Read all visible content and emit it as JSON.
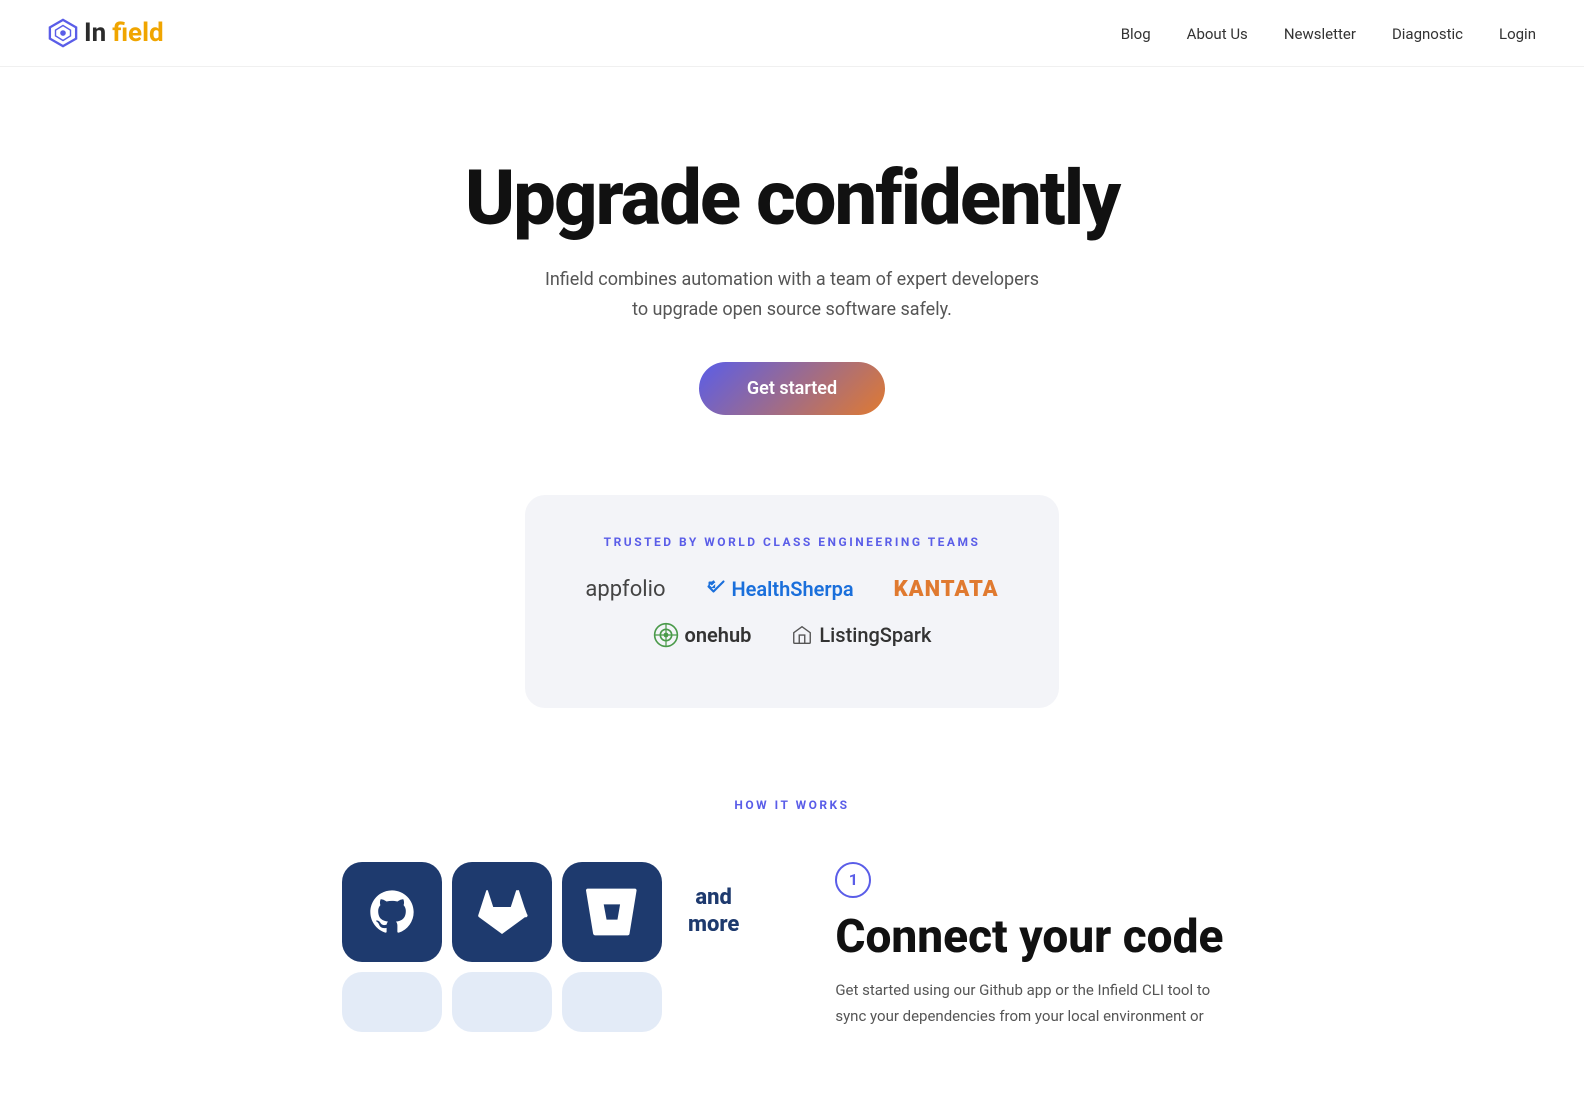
{
  "brand": {
    "name_prefix": "In",
    "name_suffix": "field",
    "logo_alt": "Infield logo"
  },
  "nav": {
    "links": [
      {
        "id": "blog",
        "label": "Blog",
        "href": "#"
      },
      {
        "id": "about",
        "label": "About Us",
        "href": "#"
      },
      {
        "id": "newsletter",
        "label": "Newsletter",
        "href": "#"
      },
      {
        "id": "diagnostic",
        "label": "Diagnostic",
        "href": "#"
      },
      {
        "id": "login",
        "label": "Login",
        "href": "#"
      }
    ]
  },
  "hero": {
    "headline": "Upgrade confidently",
    "subtext_line1": "Infield combines automation with a team of expert developers",
    "subtext_line2": "to upgrade open source software safely.",
    "cta_label": "Get started"
  },
  "trusted": {
    "label": "TRUSTED BY WORLD CLASS ENGINEERING TEAMS",
    "companies": [
      {
        "id": "appfolio",
        "name": "appfolio"
      },
      {
        "id": "healthsherpa",
        "name": "HealthSherpa"
      },
      {
        "id": "kantata",
        "name": "KANTATA"
      },
      {
        "id": "onehub",
        "name": "onehub"
      },
      {
        "id": "listingspark",
        "name": "ListingSpark"
      }
    ]
  },
  "how_it_works": {
    "label": "HOW IT WORKS",
    "step": {
      "number": "1",
      "title": "Connect your code",
      "description": "Get started using our Github app or the Infield CLI tool to sync your dependencies from your local environment or"
    },
    "and_more_label": "and\nmore"
  }
}
